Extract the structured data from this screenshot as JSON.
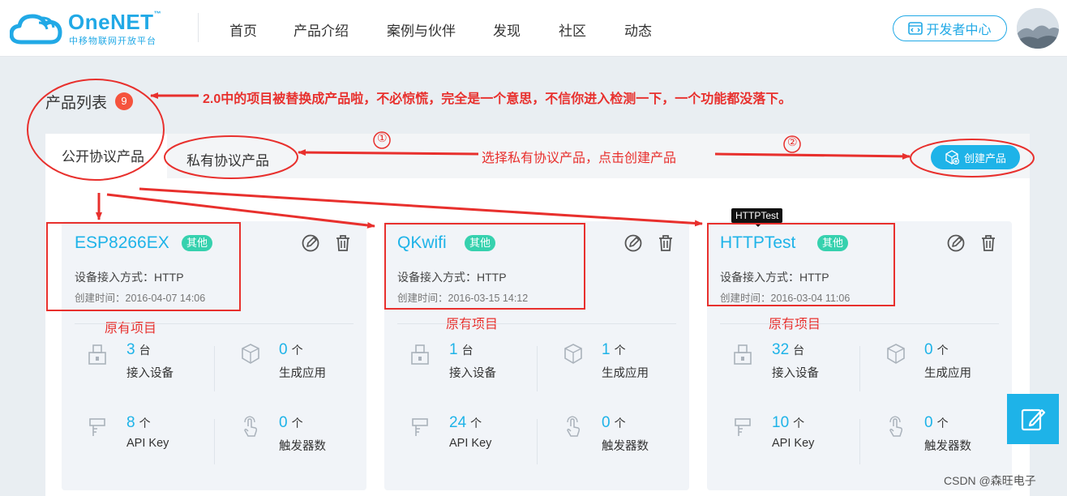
{
  "header": {
    "brand": "OneNET",
    "tm": "™",
    "subtitle": "中移物联网开放平台",
    "nav": [
      {
        "label": "首页"
      },
      {
        "label": "产品介绍"
      },
      {
        "label": "案例与伙伴"
      },
      {
        "label": "发现"
      },
      {
        "label": "社区"
      },
      {
        "label": "动态"
      }
    ],
    "dev_center": "开发者中心"
  },
  "page": {
    "title": "产品列表",
    "count": "9",
    "tabs": [
      {
        "label": "公开协议产品",
        "active": true
      },
      {
        "label": "私有协议产品",
        "active": false
      }
    ],
    "create_button": "创建产品"
  },
  "tooltip": "HTTPTest",
  "cards": [
    {
      "name": "ESP8266EX",
      "tag": "其他",
      "access": "设备接入方式：HTTP",
      "created": "创建时间：2016-04-07 14:06",
      "stats": [
        {
          "num": "3",
          "unit": "台",
          "label": "接入设备"
        },
        {
          "num": "0",
          "unit": "个",
          "label": "生成应用"
        },
        {
          "num": "8",
          "unit": "个",
          "label": "API Key"
        },
        {
          "num": "0",
          "unit": "个",
          "label": "触发器数"
        }
      ],
      "note": "原有项目"
    },
    {
      "name": "QKwifi",
      "tag": "其他",
      "access": "设备接入方式：HTTP",
      "created": "创建时间：2016-03-15 14:12",
      "stats": [
        {
          "num": "1",
          "unit": "台",
          "label": "接入设备"
        },
        {
          "num": "1",
          "unit": "个",
          "label": "生成应用"
        },
        {
          "num": "24",
          "unit": "个",
          "label": "API Key"
        },
        {
          "num": "0",
          "unit": "个",
          "label": "触发器数"
        }
      ],
      "note": "原有项目"
    },
    {
      "name": "HTTPTest",
      "tag": "其他",
      "access": "设备接入方式：HTTP",
      "created": "创建时间：2016-03-04 11:06",
      "stats": [
        {
          "num": "32",
          "unit": "台",
          "label": "接入设备"
        },
        {
          "num": "0",
          "unit": "个",
          "label": "生成应用"
        },
        {
          "num": "10",
          "unit": "个",
          "label": "API Key"
        },
        {
          "num": "0",
          "unit": "个",
          "label": "触发器数"
        }
      ],
      "note": "原有项目"
    }
  ],
  "annotations": {
    "top_note": "2.0中的项目被替换成产品啦，不必惊慌，完全是一个意思，不信你进入检测一下，一个功能都没落下。",
    "mid_note": "选择私有协议产品，点击创建产品",
    "step1": "①",
    "step2": "②"
  },
  "watermark": "CSDN @森旺电子",
  "colors": {
    "accent": "#1eb3e8",
    "tag": "#36d1ae",
    "badge": "#f5533d",
    "annotation": "#e8302d"
  }
}
